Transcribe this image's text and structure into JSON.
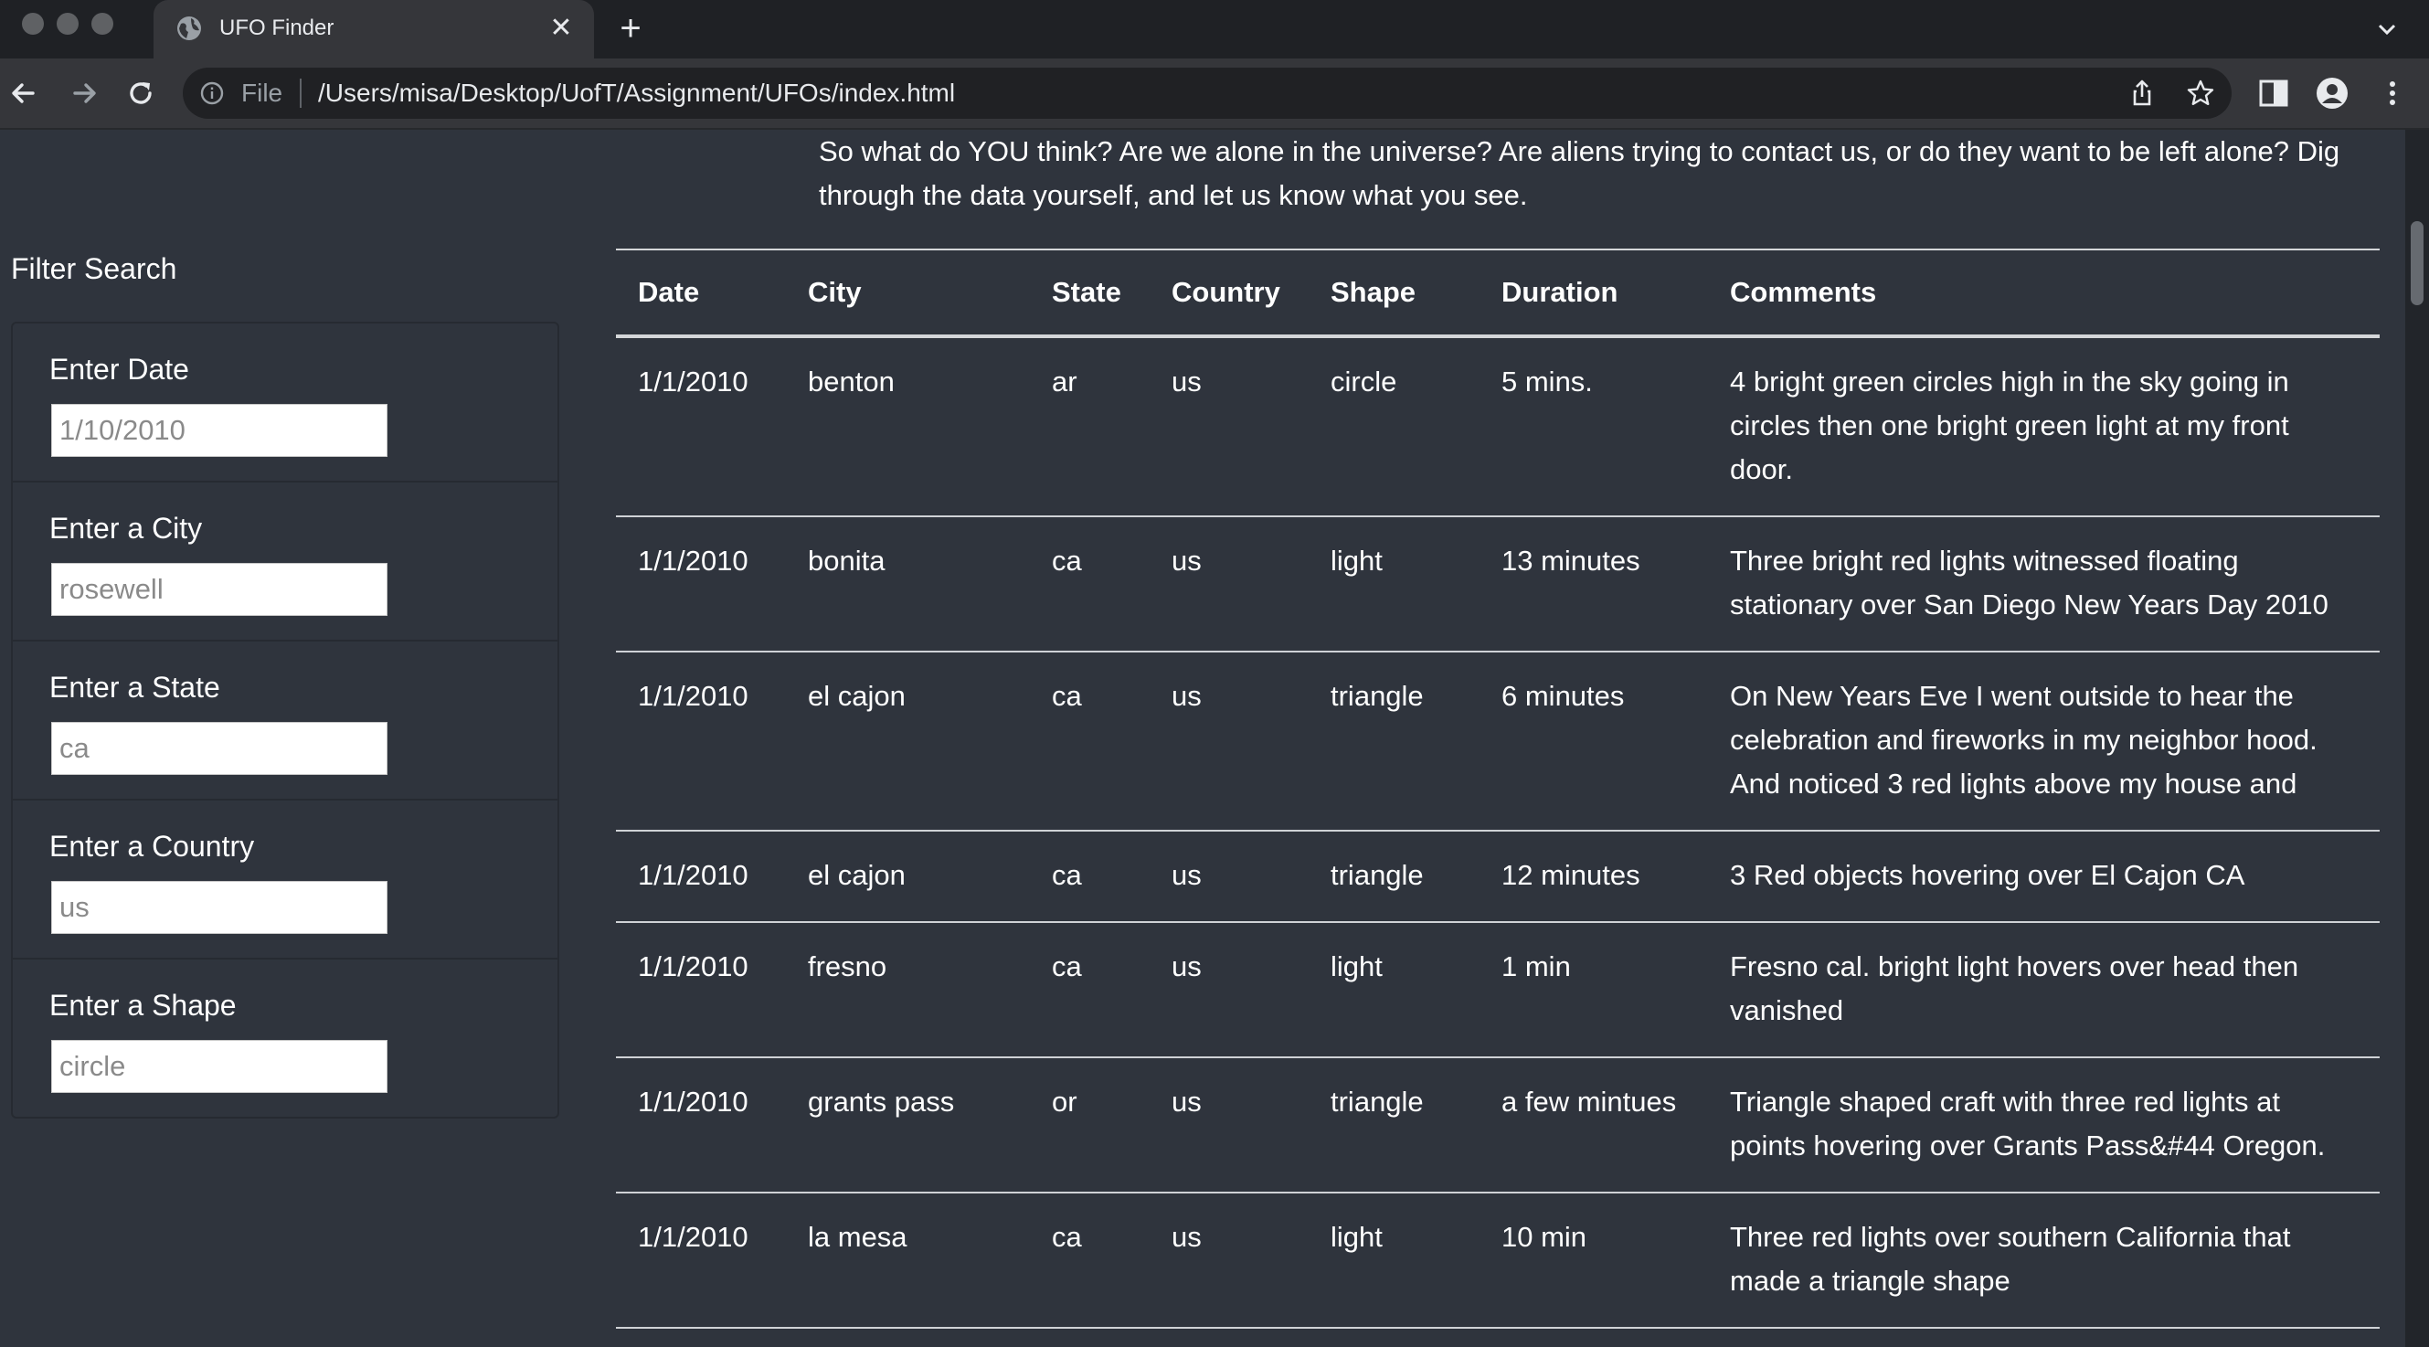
{
  "browser": {
    "tab_title": "UFO Finder",
    "tab_close": "✕",
    "new_tab": "+",
    "address_scheme": "File",
    "url": "/Users/misa/Desktop/UofT/Assignment/UFOs/index.html"
  },
  "page": {
    "intro_text": "So what do YOU think? Are we alone in the universe? Are aliens trying to contact us, or do they want to be left alone? Dig through the data yourself, and let us know what you see.",
    "filter": {
      "title": "Filter Search",
      "fields": [
        {
          "label": "Enter Date",
          "placeholder": "1/10/2010",
          "value": ""
        },
        {
          "label": "Enter a City",
          "placeholder": "rosewell",
          "value": ""
        },
        {
          "label": "Enter a State",
          "placeholder": "ca",
          "value": ""
        },
        {
          "label": "Enter a Country",
          "placeholder": "us",
          "value": ""
        },
        {
          "label": "Enter a Shape",
          "placeholder": "circle",
          "value": ""
        }
      ]
    },
    "table": {
      "headers": [
        "Date",
        "City",
        "State",
        "Country",
        "Shape",
        "Duration",
        "Comments"
      ],
      "rows": [
        [
          "1/1/2010",
          "benton",
          "ar",
          "us",
          "circle",
          "5 mins.",
          "4 bright green circles high in the sky going in circles then one bright green light at my front door."
        ],
        [
          "1/1/2010",
          "bonita",
          "ca",
          "us",
          "light",
          "13 minutes",
          "Three bright red lights witnessed floating stationary over San Diego New Years Day 2010"
        ],
        [
          "1/1/2010",
          "el cajon",
          "ca",
          "us",
          "triangle",
          "6 minutes",
          "On New Years Eve I went outside to hear the celebration and fireworks in my neighbor hood. And noticed 3 red lights above my house and"
        ],
        [
          "1/1/2010",
          "el cajon",
          "ca",
          "us",
          "triangle",
          "12 minutes",
          "3 Red objects hovering over El Cajon CA"
        ],
        [
          "1/1/2010",
          "fresno",
          "ca",
          "us",
          "light",
          "1 min",
          "Fresno cal. bright light hovers over head then vanished"
        ],
        [
          "1/1/2010",
          "grants pass",
          "or",
          "us",
          "triangle",
          "a few mintues",
          "Triangle shaped craft with three red lights at points hovering over Grants Pass&#44 Oregon."
        ],
        [
          "1/1/2010",
          "la mesa",
          "ca",
          "us",
          "light",
          "10 min",
          "Three red lights over southern California that made a triangle shape"
        ]
      ]
    }
  },
  "colors": {
    "page_background": "#2f343d",
    "chrome_background": "#35363a",
    "tabbar_background": "#1f2125"
  },
  "icons": [
    "globe-icon",
    "close-icon",
    "plus-icon",
    "chevron-down-icon",
    "back-arrow-icon",
    "forward-arrow-icon",
    "reload-icon",
    "info-icon",
    "share-icon",
    "star-icon",
    "side-panel-icon",
    "profile-icon",
    "more-menu-icon"
  ]
}
